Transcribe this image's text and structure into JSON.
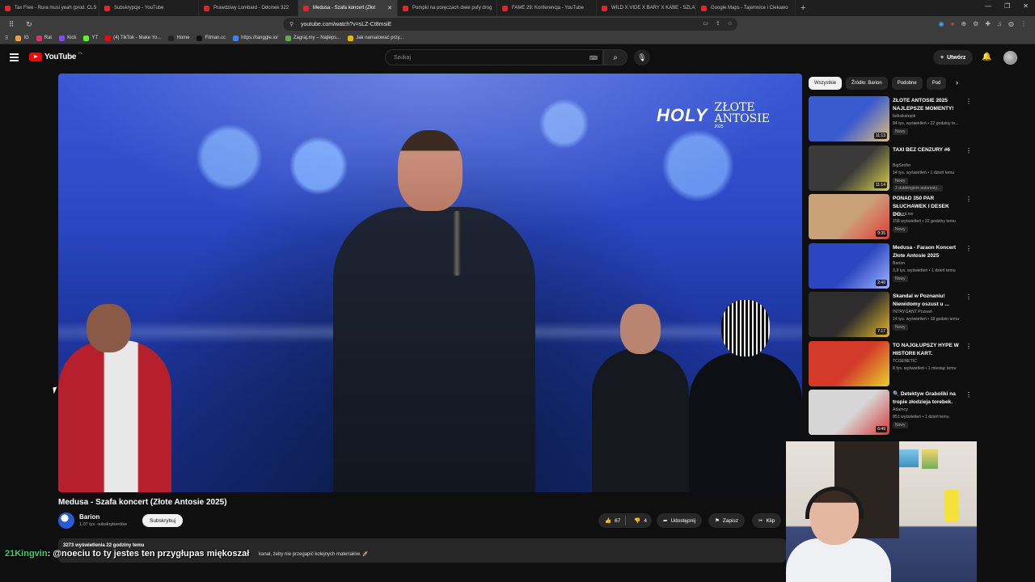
{
  "browser": {
    "tabs": [
      {
        "title": "Tax Free - Rura musi yeah (prod. CLS",
        "active": false
      },
      {
        "title": "Subskrypcje - YouTube",
        "active": false
      },
      {
        "title": "Prawdziwy Lombard - Odcinek 322",
        "active": false
      },
      {
        "title": "Medusa - Szafa koncert (Złot",
        "active": true
      },
      {
        "title": "Pompki na poręczach dwie pufy drog",
        "active": false
      },
      {
        "title": "FAME 29: Konferencja - YouTube",
        "active": false
      },
      {
        "title": "WILD X VIDE X BARY X KABE - SZLAK",
        "active": false
      },
      {
        "title": "Google Maps - Tajemnice i Ciekawo",
        "active": false
      }
    ],
    "url": "youtube.com/watch?v=sLZ-Ct8msiE",
    "bookmarks": [
      "IG",
      "Rat",
      "Kick",
      "YT",
      "(4) TikTok - Make Yo...",
      "Home",
      "Filman.cc",
      "https://tanggle.io/",
      "Zagraj.my – Najleps...",
      "Jak namalować przy..."
    ]
  },
  "header": {
    "logo_text": "YouTube",
    "logo_country": "PL",
    "search_placeholder": "Szukaj",
    "create_label": "Utwórz"
  },
  "player": {
    "watermark_brand": "HOLY",
    "watermark_title": "ZŁOTE ANTOSIE",
    "watermark_year": "2025"
  },
  "video": {
    "title": "Medusa - Szafa koncert (Złote Antosie 2025)",
    "channel": "Barion",
    "subscribers": "1,07 tys. subskrybentów",
    "subscribe_label": "Subskrybuj",
    "likes": "67",
    "dislikes": "4",
    "share_label": "Udostępnij",
    "save_label": "Zapisz",
    "clip_label": "Klip",
    "views_date": "3273 wyświetlenia  22 godziny temu",
    "description_tail": "kanał, żeby nie przegapić kolejnych materiałów. 🚀"
  },
  "chat": {
    "user": "21Kingvin",
    "message": ": @noeciu to ty jestes ten przygłupas miękoszał"
  },
  "sidebar": {
    "chips": [
      "Wszystkie",
      "Źródło: Barion",
      "Podobne",
      "Pod"
    ],
    "recommendations": [
      {
        "title": "ZŁOTE ANTOSIE 2025 NAJLEPSZE MOMENTY!",
        "channel": "boksikstopik",
        "meta": "84 tys. wyświetleń • 22 godziny te...",
        "badge": "Nowy",
        "extra": "",
        "duration": "11:13",
        "colors": [
          "#3a5bd0",
          "#e0c07a"
        ]
      },
      {
        "title": "TAXI BEZ CENZURY #6",
        "channel": "BigSzofer",
        "meta": "14 tys. wyświetleń • 1 dzień temu",
        "badge": "Nowy",
        "extra": "2 dubbingiem automaty...",
        "duration": "11:14",
        "colors": [
          "#3a3a3a",
          "#d9d24a"
        ]
      },
      {
        "title": "PONAD 350 PAR SŁUCHAWEK I DESEK DO...",
        "channel": "MugenLive",
        "meta": "158 wyświetleń • 22 godziny temu",
        "badge": "Nowy",
        "extra": "",
        "duration": "9:35",
        "colors": [
          "#c9a27a",
          "#e33a3a"
        ]
      },
      {
        "title": "Medusa - Faraon Koncert Złote Antosie 2025",
        "channel": "Barion",
        "meta": "3,3 tys. wyświetleń • 1 dzień temu",
        "badge": "Nowy",
        "extra": "",
        "duration": "2:40",
        "colors": [
          "#2b46c0",
          "#9fb4ff"
        ]
      },
      {
        "title": "Skandal w Poznaniu! Niewidomy oszust u ...",
        "channel": "INTRYGANT Poznań",
        "meta": "14 tys. wyświetleń • 18 godzin temu",
        "badge": "Nowy",
        "extra": "",
        "duration": "7:17",
        "colors": [
          "#2e2e2e",
          "#e4b82a"
        ]
      },
      {
        "title": "TO NAJGŁUPSZY HYPE W HISTORII KART.",
        "channel": "TCGENETIC",
        "meta": "8 tys. wyświetleń • 1 miesiąc temu",
        "badge": "",
        "extra": "",
        "duration": "",
        "colors": [
          "#d43a2a",
          "#e6d12a"
        ]
      },
      {
        "title": "🔍 Detektyw Graboliki na tropie złodzieja torebek.",
        "channel": "Adamcy",
        "meta": "851 wyświetleń • 1 dzień temu",
        "badge": "Nowy",
        "extra": "",
        "duration": "6:49",
        "colors": [
          "#d6d6d6",
          "#d83a3a"
        ]
      }
    ]
  }
}
